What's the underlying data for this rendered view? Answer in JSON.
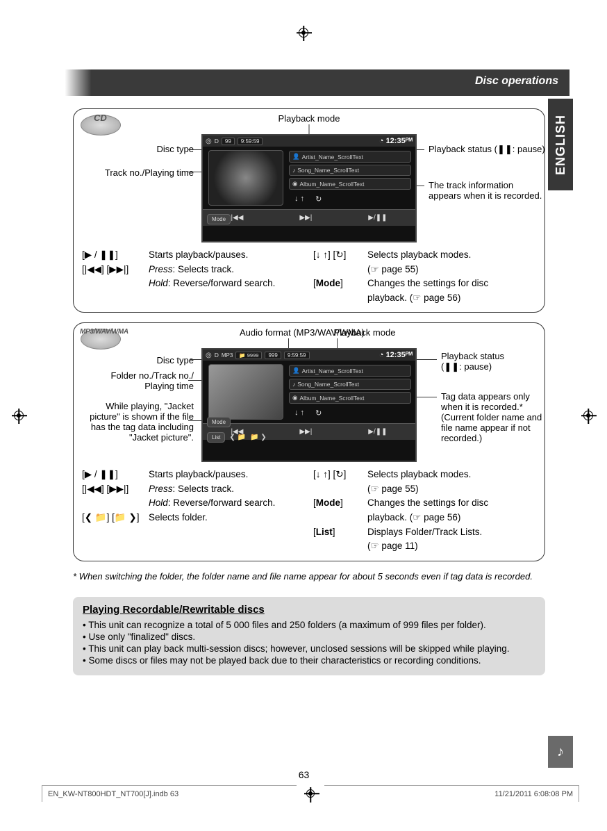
{
  "header": {
    "title": "Disc operations"
  },
  "lang_tab": "ENGLISH",
  "page_number": "63",
  "footer": {
    "left": "EN_KW-NT800HDT_NT700[J].indb   63",
    "right": "11/21/2011   6:08:08 PM"
  },
  "cd": {
    "badge": "CD",
    "callouts": {
      "playback_mode": "Playback mode",
      "disc_type": "Disc type",
      "track_playing": "Track no./Playing time",
      "playback_status": "Playback status (❚❚: pause)",
      "track_info1": "The track information",
      "track_info2": "appears when it is recorded."
    },
    "screen": {
      "disc_letter": "D",
      "box1": "99",
      "box2": "9:59:59",
      "clock": "12:35",
      "artist": "Artist_Name_ScrollText",
      "song": "Song_Name_ScrollText",
      "album": "Album_Name_ScrollText",
      "mode_btn": "Mode"
    },
    "buttons": {
      "play_pause_key": "[▶ / ❚❚]",
      "play_pause_desc": "Starts playback/pauses.",
      "skip_key": "[|◀◀] [▶▶|]",
      "skip_desc_press_label": "Press",
      "skip_desc_press": ": Selects track.",
      "skip_desc_hold_label": "Hold",
      "skip_desc_hold": ": Reverse/forward search.",
      "pbmode_key": "[↓ ↑] [↻]",
      "pbmode_desc1": "Selects playback modes.",
      "pbmode_desc2": "(☞ page 55)",
      "mode_key": "[Mode]",
      "mode_desc1": "Changes the settings for disc",
      "mode_desc2": "playback. (☞ page 56)"
    }
  },
  "mp3": {
    "badge": "MP3/WAV/WMA",
    "callouts": {
      "audio_format": "Audio format (MP3/WAV/WMA)",
      "playback_mode": "Playback mode",
      "disc_type": "Disc type",
      "folder_track1": "Folder no./Track no./",
      "folder_track2": "Playing time",
      "jacket1": "While playing, \"Jacket",
      "jacket2": "picture\" is shown if the file",
      "jacket3": "has the tag data including",
      "jacket4": "\"Jacket picture\".",
      "playback_status1": "Playback status",
      "playback_status2": "(❚❚: pause)",
      "tag1": "Tag data appears only",
      "tag2": "when it is recorded.*",
      "tag3": "(Current folder name and",
      "tag4": "file name appear if not",
      "tag5": "recorded.)"
    },
    "screen": {
      "disc_letter": "D",
      "folder": "9999",
      "track": "999",
      "time": "9:59:59",
      "clock": "12:35",
      "artist": "Artist_Name_ScrollText",
      "song": "Song_Name_ScrollText",
      "album": "Album_Name_ScrollText",
      "mode_btn": "Mode",
      "list_btn": "List"
    },
    "buttons": {
      "play_pause_key": "[▶ / ❚❚]",
      "play_pause_desc": "Starts playback/pauses.",
      "skip_key": "[|◀◀] [▶▶|]",
      "skip_desc_press_label": "Press",
      "skip_desc_press": ": Selects track.",
      "skip_desc_hold_label": "Hold",
      "skip_desc_hold": ": Reverse/forward search.",
      "folder_key": "[❮ 📁] [📁 ❯]",
      "folder_desc": "Selects folder.",
      "pbmode_key": "[↓ ↑] [↻]",
      "pbmode_desc1": "Selects playback modes.",
      "pbmode_desc2": "(☞ page 55)",
      "mode_key": "[Mode]",
      "mode_desc1": "Changes the settings for disc",
      "mode_desc2": "playback. (☞ page 56)",
      "list_key": "[List]",
      "list_desc1": "Displays Folder/Track Lists.",
      "list_desc2": "(☞ page 11)"
    }
  },
  "footnote": "*  When switching the folder, the folder name and file name appear for about 5 seconds even if tag data is recorded.",
  "infobox": {
    "title": "Playing Recordable/Rewritable discs",
    "items": [
      "This unit can recognize a total of 5 000 files and 250 folders (a maximum of 999 files per folder).",
      "Use only \"finalized\" discs.",
      "This unit can play back multi-session discs; however, unclosed sessions will be skipped while playing.",
      "Some discs or files may not be played back due to their characteristics or recording conditions."
    ]
  }
}
